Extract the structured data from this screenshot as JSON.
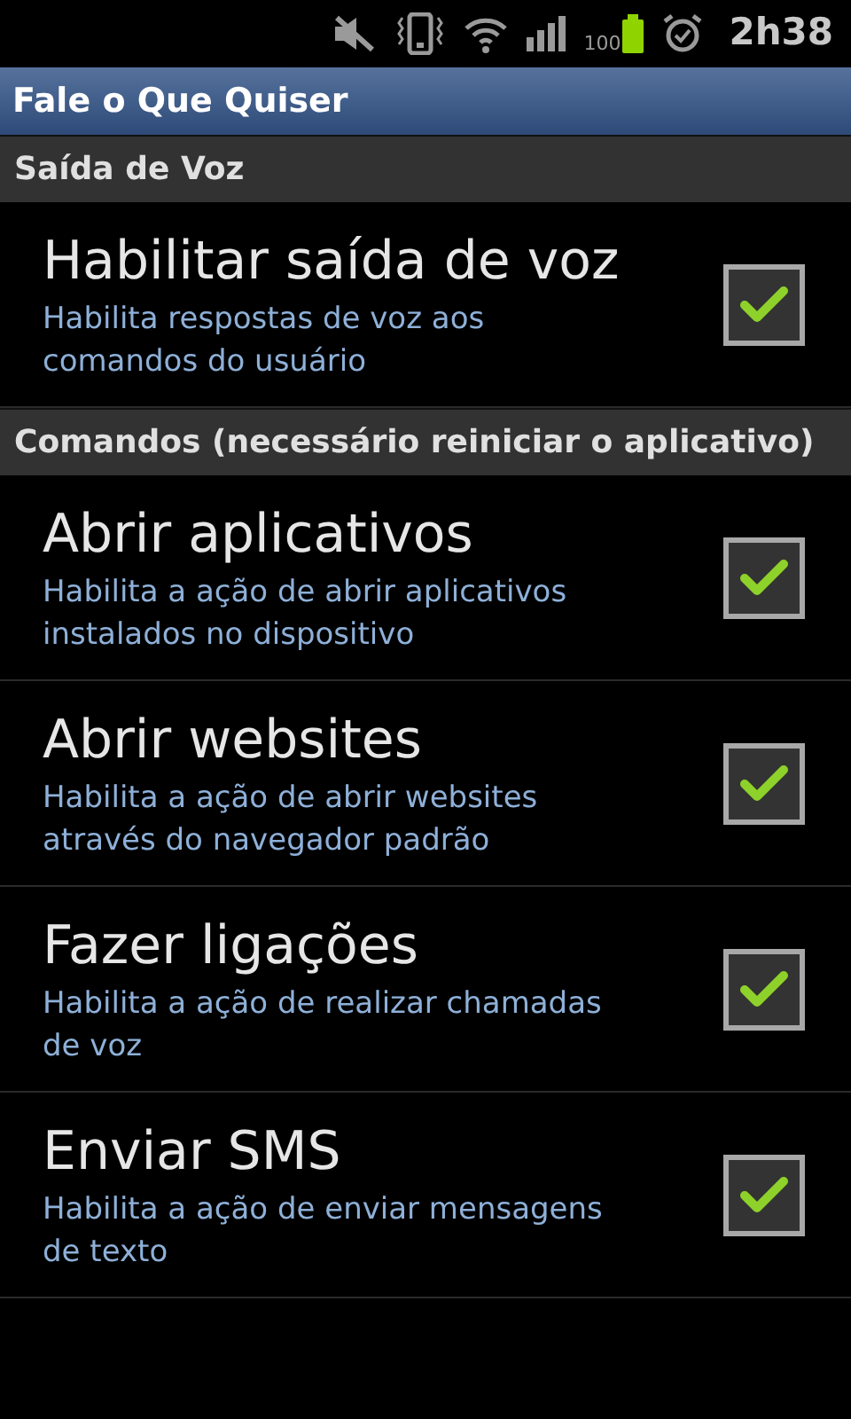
{
  "status_bar": {
    "battery": "100",
    "time": "2h38"
  },
  "window": {
    "title": "Fale o Que Quiser"
  },
  "sections": [
    {
      "header": "Saída de Voz",
      "items": [
        {
          "title": "Habilitar saída de voz",
          "summary": "Habilita respostas de voz aos comandos do usuário",
          "checked": true
        }
      ]
    },
    {
      "header": "Comandos (necessário reiniciar o aplicativo)",
      "items": [
        {
          "title": "Abrir aplicativos",
          "summary": "Habilita a ação de abrir aplicativos instalados no dispositivo",
          "checked": true
        },
        {
          "title": "Abrir websites",
          "summary": "Habilita a ação de abrir websites através do navegador padrão",
          "checked": true
        },
        {
          "title": "Fazer ligações",
          "summary": "Habilita a ação de realizar chamadas de voz",
          "checked": true
        },
        {
          "title": "Enviar SMS",
          "summary": "Habilita a ação de enviar mensagens de texto",
          "checked": true
        }
      ]
    }
  ]
}
